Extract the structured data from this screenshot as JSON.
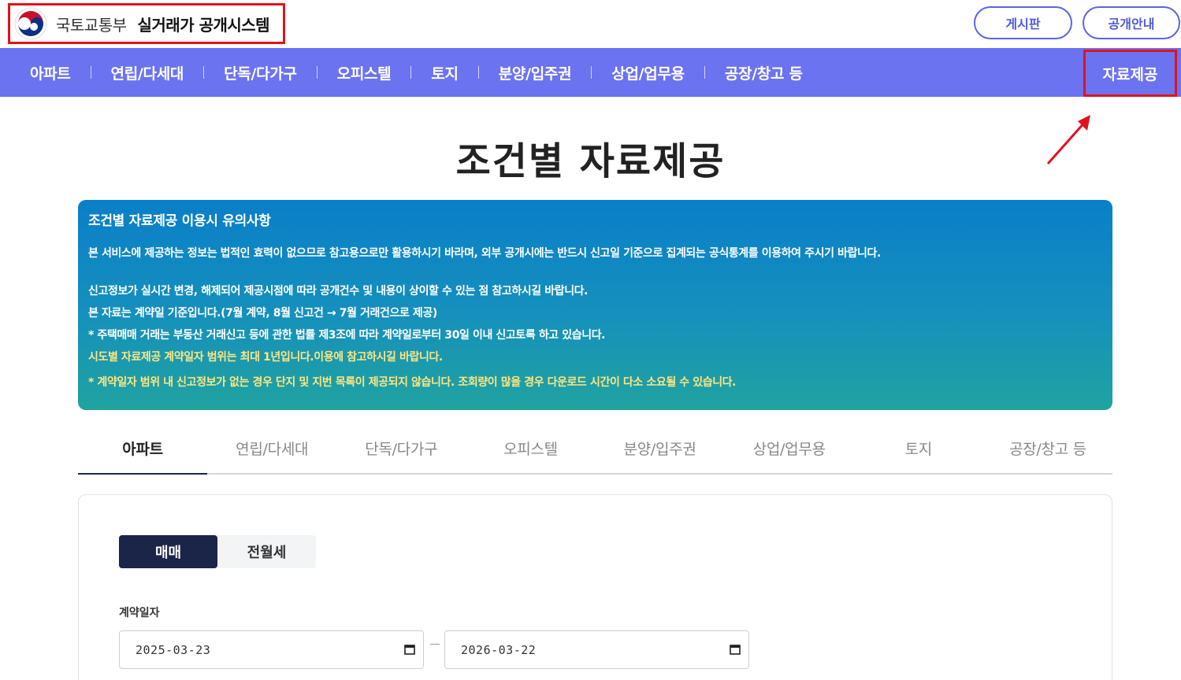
{
  "header": {
    "ministry": "국토교통부",
    "system": "실거래가 공개시스템",
    "buttons": {
      "board": "게시판",
      "guide": "공개안내"
    }
  },
  "nav": {
    "items": [
      "아파트",
      "연립/다세대",
      "단독/다가구",
      "오피스텔",
      "토지",
      "분양/입주권",
      "상업/업무용",
      "공장/창고 등"
    ],
    "data_provision": "자료제공"
  },
  "page": {
    "title": "조건별 자료제공"
  },
  "notice": {
    "title": "조건별 자료제공 이용시 유의사항",
    "line1": "본 서비스에 제공하는 정보는 법적인 효력이 없으므로 참고용으로만 활용하시기 바라며, 외부 공개시에는 반드시 신고일 기준으로 집계되는 공식통계를 이용하여 주시기 바랍니다.",
    "line2": "신고정보가 실시간 변경, 해제되어 제공시점에 따라 공개건수 및 내용이 상이할 수 있는 점 참고하시길 바랍니다.",
    "line3": "본 자료는 계약일 기준입니다.(7월 계약, 8월 신고건 → 7월 거래건으로 제공)",
    "line4": "* 주택매매 거래는 부동산 거래신고 등에 관한 법률 제3조에 따라 계약일로부터 30일 이내 신고토록 하고 있습니다.",
    "line5": "시도별 자료제공 계약일자 범위는 최대 1년입니다.이용에 참고하시길 바랍니다.",
    "line6": "* 계약일자 범위 내 신고정보가 없는 경우 단지 및 지번 목록이 제공되지 않습니다. 조회량이 많을 경우 다운로드 시간이 다소 소요될 수 있습니다."
  },
  "tabs": [
    "아파트",
    "연립/다세대",
    "단독/다가구",
    "오피스텔",
    "분양/입주권",
    "상업/업무용",
    "토지",
    "공장/창고 등"
  ],
  "form": {
    "trade_types": {
      "sale": "매매",
      "lease": "전월세"
    },
    "contract_date_label": "계약일자",
    "date_from": "2025-03-23",
    "date_to": "2026-03-22"
  },
  "colors": {
    "nav_bg": "#6b73f0",
    "highlight": "#e0131d",
    "active_dark": "#1b2548"
  }
}
